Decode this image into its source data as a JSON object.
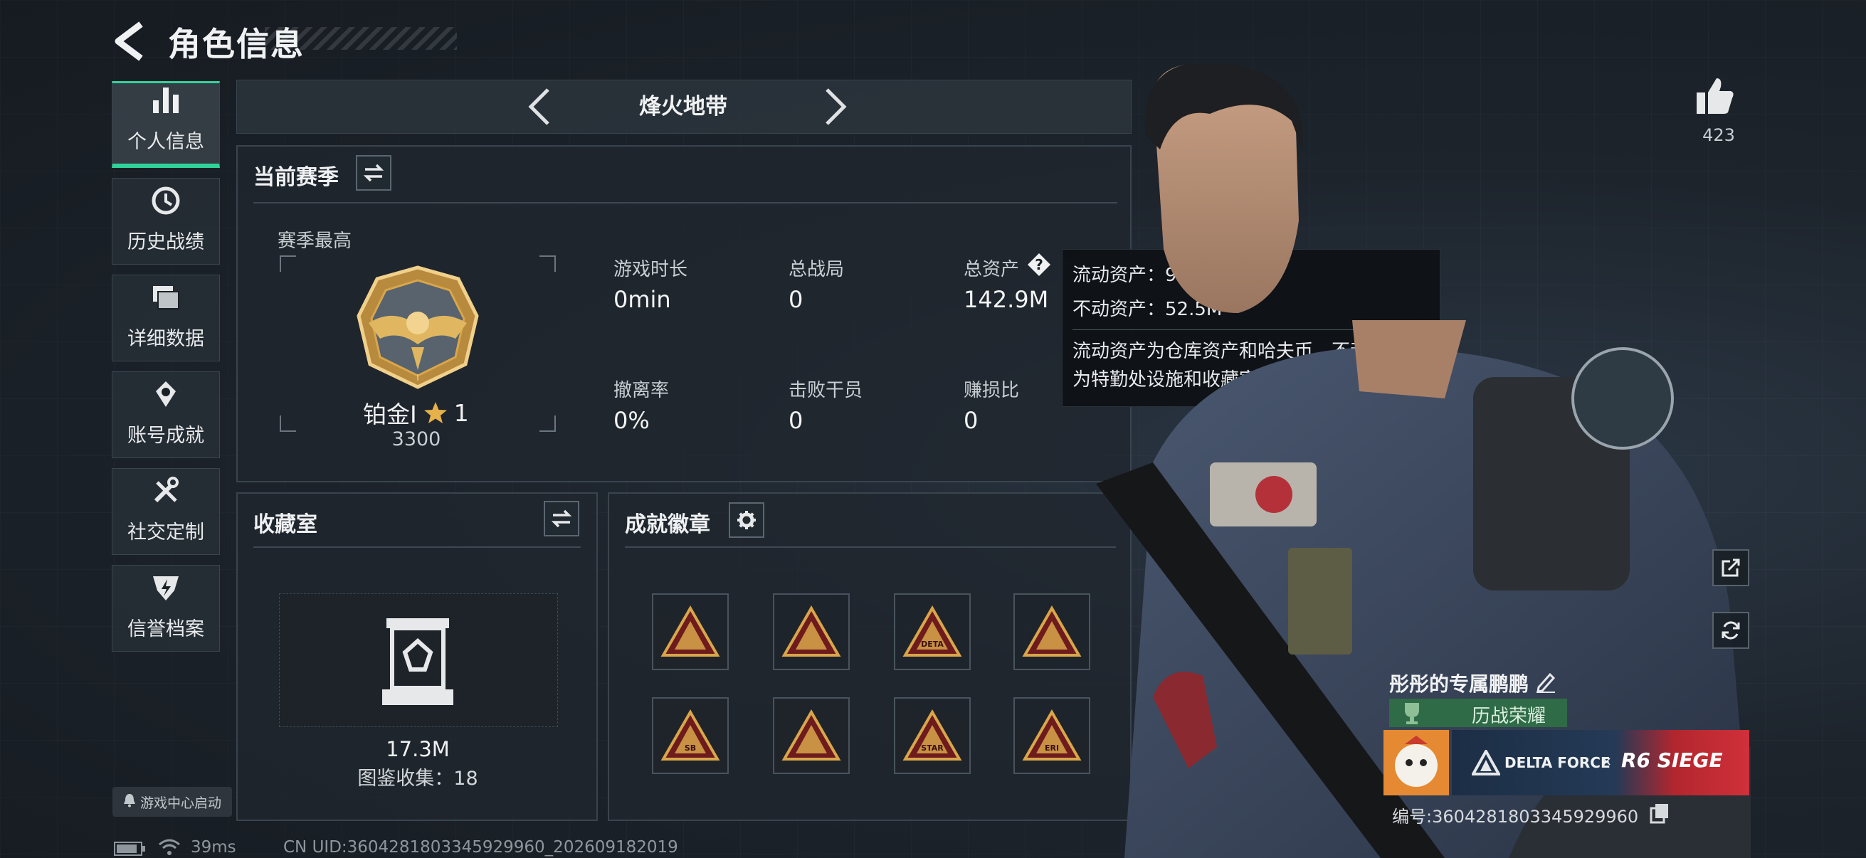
{
  "header": {
    "title": "角色信息"
  },
  "sidebar": {
    "items": [
      {
        "label": "个人信息",
        "icon": "bar-chart-icon",
        "active": true
      },
      {
        "label": "历史战绩",
        "icon": "history-clock-icon"
      },
      {
        "label": "详细数据",
        "icon": "folder-stack-icon"
      },
      {
        "label": "账号成就",
        "icon": "achievement-medal-icon"
      },
      {
        "label": "社交定制",
        "icon": "tools-icon"
      },
      {
        "label": "信誉档案",
        "icon": "credit-shield-icon"
      }
    ]
  },
  "mode_nav": {
    "label": "烽火地带"
  },
  "season": {
    "title": "当前赛季",
    "best_label": "赛季最高",
    "rank_text": "铂金Ⅰ",
    "star_count": "1",
    "rank_score": "3300",
    "stats": [
      {
        "label": "游戏时长",
        "value": "0min"
      },
      {
        "label": "总战局",
        "value": "0"
      },
      {
        "label": "总资产",
        "value": "142.9M"
      },
      {
        "label": "撤离率",
        "value": "0%"
      },
      {
        "label": "击败干员",
        "value": "0"
      },
      {
        "label": "赚损比",
        "value": "0"
      }
    ]
  },
  "tooltip": {
    "liquid": "流动资产：90.5M",
    "fixed": "不动资产：52.5M",
    "desc_line1": "流动资产为仓库资产和哈夫币，不动资产",
    "desc_line2": "为特勤处设施和收藏室设施"
  },
  "collection": {
    "title": "收藏室",
    "value": "17.3M",
    "collect_text": "图鉴收集：18"
  },
  "achievements": {
    "title": "成就徽章",
    "badge_texts": [
      "",
      "",
      "DETA",
      "",
      "SB",
      "",
      "STAR",
      "ERI"
    ]
  },
  "profile": {
    "like_count": "423",
    "name": "彤彤的专属鹏鹏",
    "honor": "历战荣耀",
    "banner": {
      "left_text": "DELTA FORCE",
      "x": "×",
      "right_text": "R6 SIEGE"
    },
    "uid_text": "编号:3604281803345929960"
  },
  "footer": {
    "ping": "39ms",
    "uid": "CN UID:3604281803345929960_202609182019",
    "launch_hint": "游戏中心启动"
  },
  "colors": {
    "accent": "#2fd39a",
    "gold": "#d9a64a",
    "panel": "#20272e"
  }
}
